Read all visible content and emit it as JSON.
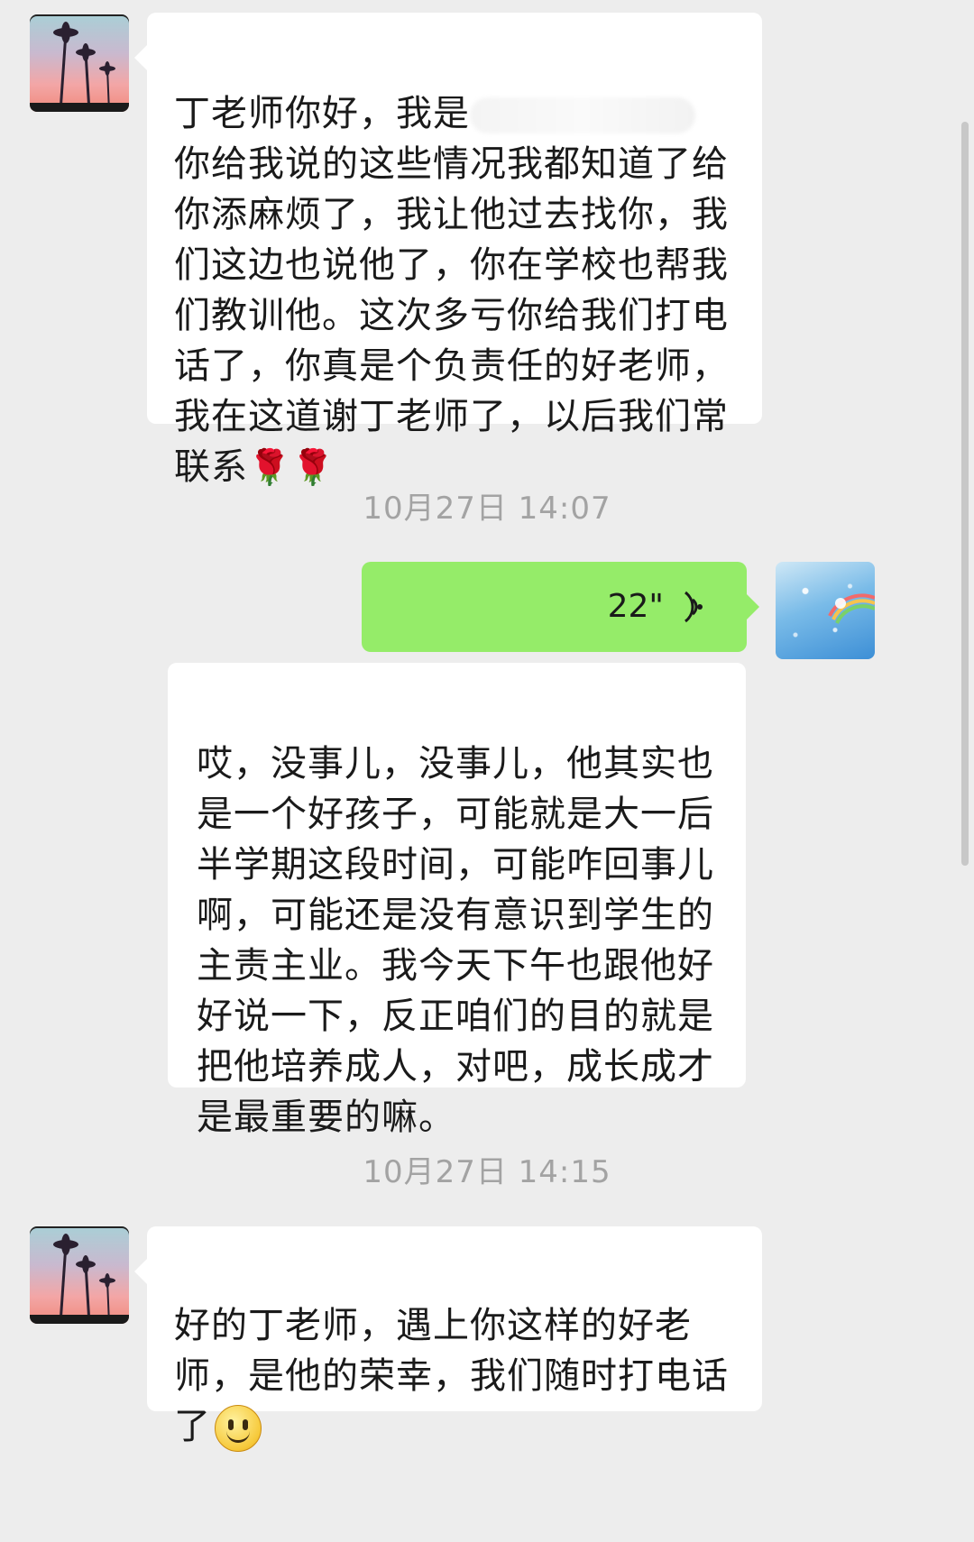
{
  "messages": [
    {
      "sender": "contact",
      "lines_before_redaction": "丁老师你好，我是",
      "text_after": "你给我说的这些情况我都知道了给\n你添麻烦了，我让他过去找你，我\n们这边也说他了，你在学校也帮我\n们教训他。这次多亏你给我们打电\n话了，你真是个负责任的好老师，\n我在这道谢丁老师了，以后我们常\n联系",
      "emojis": "🌹🌹"
    },
    {
      "sender": "me",
      "type": "voice",
      "duration": "22\""
    },
    {
      "sender": "me",
      "text": "哎，没事儿，没事儿，他其实也\n是一个好孩子，可能就是大一后\n半学期这段时间，可能咋回事儿\n啊，可能还是没有意识到学生的\n主责主业。我今天下午也跟他好\n好说一下，反正咱们的目的就是\n把他培养成人，对吧，成长成才\n是最重要的嘛。"
    },
    {
      "sender": "contact",
      "text": "好的丁老师，遇上你这样的好老\n师，是他的荣幸，我们随时打电话\n了"
    }
  ],
  "timestamps": [
    "10月27日 14:07",
    "10月27日 14:15"
  ],
  "colors": {
    "background": "#ededed",
    "bubble_contact": "#ffffff",
    "bubble_voice": "#95ec69",
    "timestamp_text": "#a3a3a3"
  },
  "icons": {
    "voice_wave": "voice-wave-icon",
    "smiley": "smiley-emoji-icon",
    "rose": "rose-emoji"
  }
}
